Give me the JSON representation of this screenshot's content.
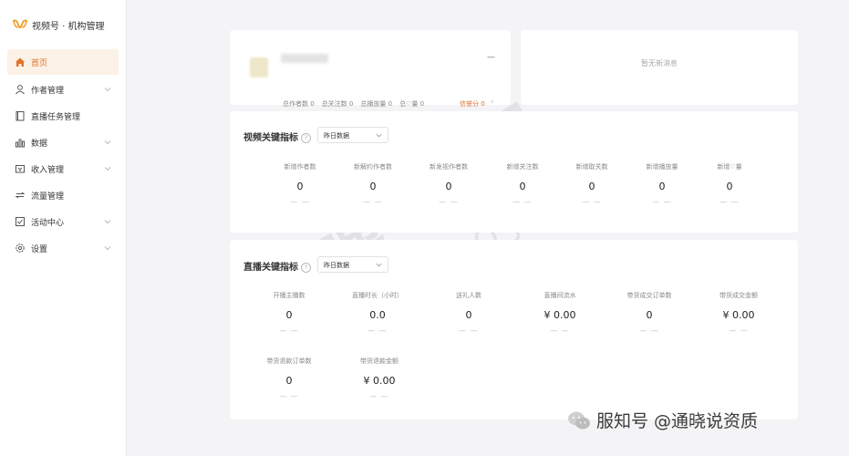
{
  "app": {
    "title": "视频号 · 机构管理"
  },
  "sidebar": {
    "items": [
      {
        "label": "首页",
        "icon": "home-icon",
        "active": true
      },
      {
        "label": "作者管理",
        "icon": "person-icon",
        "expandable": true
      },
      {
        "label": "直播任务管理",
        "icon": "document-icon",
        "expandable": false
      },
      {
        "label": "数据",
        "icon": "bar-chart-icon",
        "expandable": true
      },
      {
        "label": "收入管理",
        "icon": "wallet-icon",
        "expandable": true
      },
      {
        "label": "流量管理",
        "icon": "traffic-icon",
        "expandable": false
      },
      {
        "label": "活动中心",
        "icon": "checkbox-icon",
        "expandable": true
      },
      {
        "label": "设置",
        "icon": "gear-icon",
        "expandable": true
      }
    ]
  },
  "profile": {
    "dash": "—",
    "stats": [
      "总作者数 0",
      "总关注数 0",
      "总播放量 0",
      "总♡量 0"
    ],
    "credit": "信誉分 0"
  },
  "messages": {
    "empty_text": "暂无新消息"
  },
  "video_section": {
    "title": "视频关键指标",
    "select_value": "昨日数据",
    "metrics": [
      {
        "label": "新增作者数",
        "value": "0",
        "compare": "— —"
      },
      {
        "label": "新解约作者数",
        "value": "0",
        "compare": "— —"
      },
      {
        "label": "新发视作者数",
        "value": "0",
        "compare": "— —"
      },
      {
        "label": "新增关注数",
        "value": "0",
        "compare": "— —"
      },
      {
        "label": "新增取关数",
        "value": "0",
        "compare": "— —"
      },
      {
        "label": "新增播放量",
        "value": "0",
        "compare": "— —"
      },
      {
        "label": "新增♡量",
        "value": "0",
        "compare": "— —"
      }
    ]
  },
  "live_section": {
    "title": "直播关键指标",
    "select_value": "昨日数据",
    "metrics": [
      {
        "label": "开播主播数",
        "value": "0",
        "compare": "— —"
      },
      {
        "label": "直播时长（小时）",
        "value": "0.0",
        "compare": "— —"
      },
      {
        "label": "送礼人数",
        "value": "0",
        "compare": "— —"
      },
      {
        "label": "直播间流水",
        "value": "¥ 0.00",
        "compare": "— —"
      },
      {
        "label": "带货成交订单数",
        "value": "0",
        "compare": "— —"
      },
      {
        "label": "带货成交金额",
        "value": "¥ 0.00",
        "compare": "— —"
      },
      {
        "label": "带货退款订单数",
        "value": "0",
        "compare": "— —"
      },
      {
        "label": "带货退款金额",
        "value": "¥ 0.00",
        "compare": "— —"
      }
    ]
  },
  "watermark": {
    "text": "服知号 @通晓说资质",
    "big_text": "通晓集团",
    "latin_text": "TONG XIAO JI TUAN"
  },
  "colors": {
    "accent": "#e0742a",
    "active_bg": "#fbf1e6",
    "page_bg": "#f4f4f6"
  }
}
